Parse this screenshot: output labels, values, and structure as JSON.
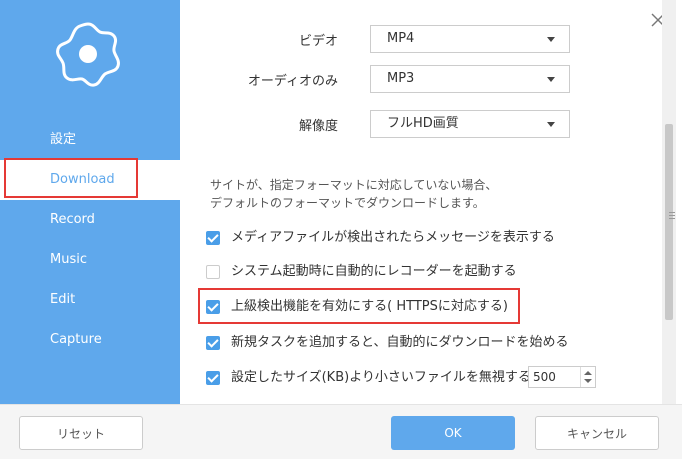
{
  "sidebar": {
    "items": [
      {
        "label": "設定"
      },
      {
        "label": "Download"
      },
      {
        "label": "Record"
      },
      {
        "label": "Music"
      },
      {
        "label": "Edit"
      },
      {
        "label": "Capture"
      }
    ],
    "active_item": "Download"
  },
  "settings": {
    "video": {
      "label": "ビデオ",
      "value": "MP4"
    },
    "audio_only": {
      "label": "オーディオのみ",
      "value": "MP3"
    },
    "resolution": {
      "label": "解像度",
      "value": "フルHD画質"
    }
  },
  "description": {
    "line1": "サイトが、指定フォーマットに対応していない場合、",
    "line2": "デフォルトのフォーマットでダウンロードします。"
  },
  "options": [
    {
      "label": "メディアファイルが検出されたらメッセージを表示する",
      "checked": true
    },
    {
      "label": "システム起動時に自動的にレコーダーを起動する",
      "checked": false
    },
    {
      "label": "上級検出機能を有効にする( HTTPSに対応する)",
      "checked": true
    },
    {
      "label": "新規タスクを追加すると、自動的にダウンロードを始める",
      "checked": true
    },
    {
      "label": "設定したサイズ(KB)より小さいファイルを無視する",
      "checked": true
    }
  ],
  "min_size_kb": "500",
  "footer": {
    "reset_label": "リセット",
    "ok_label": "OK",
    "cancel_label": "キャンセル"
  },
  "colors": {
    "accent": "#5fa8ec",
    "highlight_border": "#e53935"
  }
}
